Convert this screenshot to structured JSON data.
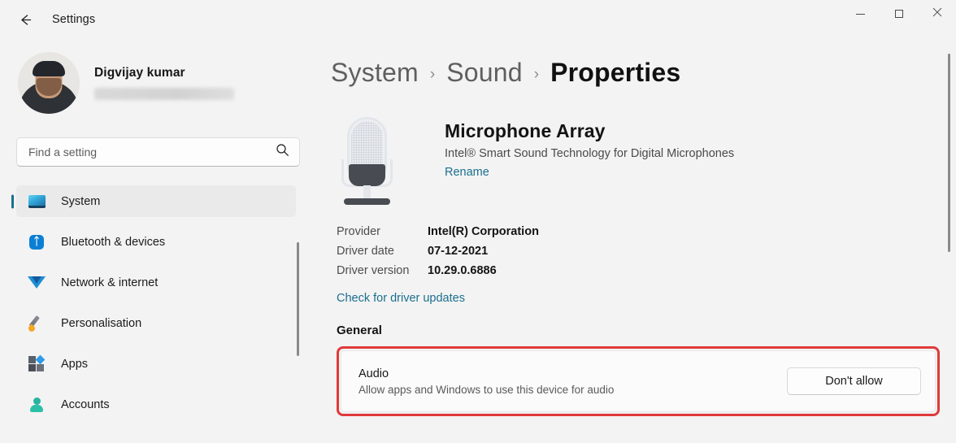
{
  "window": {
    "app_title": "Settings",
    "back_icon": "back-arrow-icon",
    "minimize_label": "Minimise",
    "maximize_label": "Maximise",
    "close_label": "Close"
  },
  "sidebar": {
    "profile": {
      "name": "Digvijay kumar",
      "email_redacted": ""
    },
    "search": {
      "placeholder": "Find a setting",
      "value": "",
      "icon": "search-icon"
    },
    "items": [
      {
        "label": "System",
        "icon": "monitor-icon",
        "selected": true
      },
      {
        "label": "Bluetooth & devices",
        "icon": "bluetooth-icon",
        "selected": false
      },
      {
        "label": "Network & internet",
        "icon": "wifi-icon",
        "selected": false
      },
      {
        "label": "Personalisation",
        "icon": "paintbrush-icon",
        "selected": false
      },
      {
        "label": "Apps",
        "icon": "apps-icon",
        "selected": false
      },
      {
        "label": "Accounts",
        "icon": "account-icon",
        "selected": false
      }
    ]
  },
  "main": {
    "breadcrumb": [
      {
        "label": "System",
        "current": false
      },
      {
        "label": "Sound",
        "current": false
      },
      {
        "label": "Properties",
        "current": true
      }
    ],
    "breadcrumb_separator": "›",
    "device": {
      "icon": "microphone-icon",
      "name": "Microphone Array",
      "description": "Intel® Smart Sound Technology for Digital Microphones",
      "rename_label": "Rename"
    },
    "driver": {
      "rows": [
        {
          "key": "Provider",
          "value": "Intel(R) Corporation"
        },
        {
          "key": "Driver date",
          "value": "07-12-2021"
        },
        {
          "key": "Driver version",
          "value": "10.29.0.6886"
        }
      ],
      "update_link": "Check for driver updates"
    },
    "general": {
      "section_title": "General",
      "audio": {
        "title": "Audio",
        "subtitle": "Allow apps and Windows to use this device for audio",
        "button_label": "Don't allow"
      }
    }
  },
  "colors": {
    "highlight_border": "#e03a3a",
    "accent": "#1a6f8e",
    "window_background": "#f3f3f3"
  }
}
